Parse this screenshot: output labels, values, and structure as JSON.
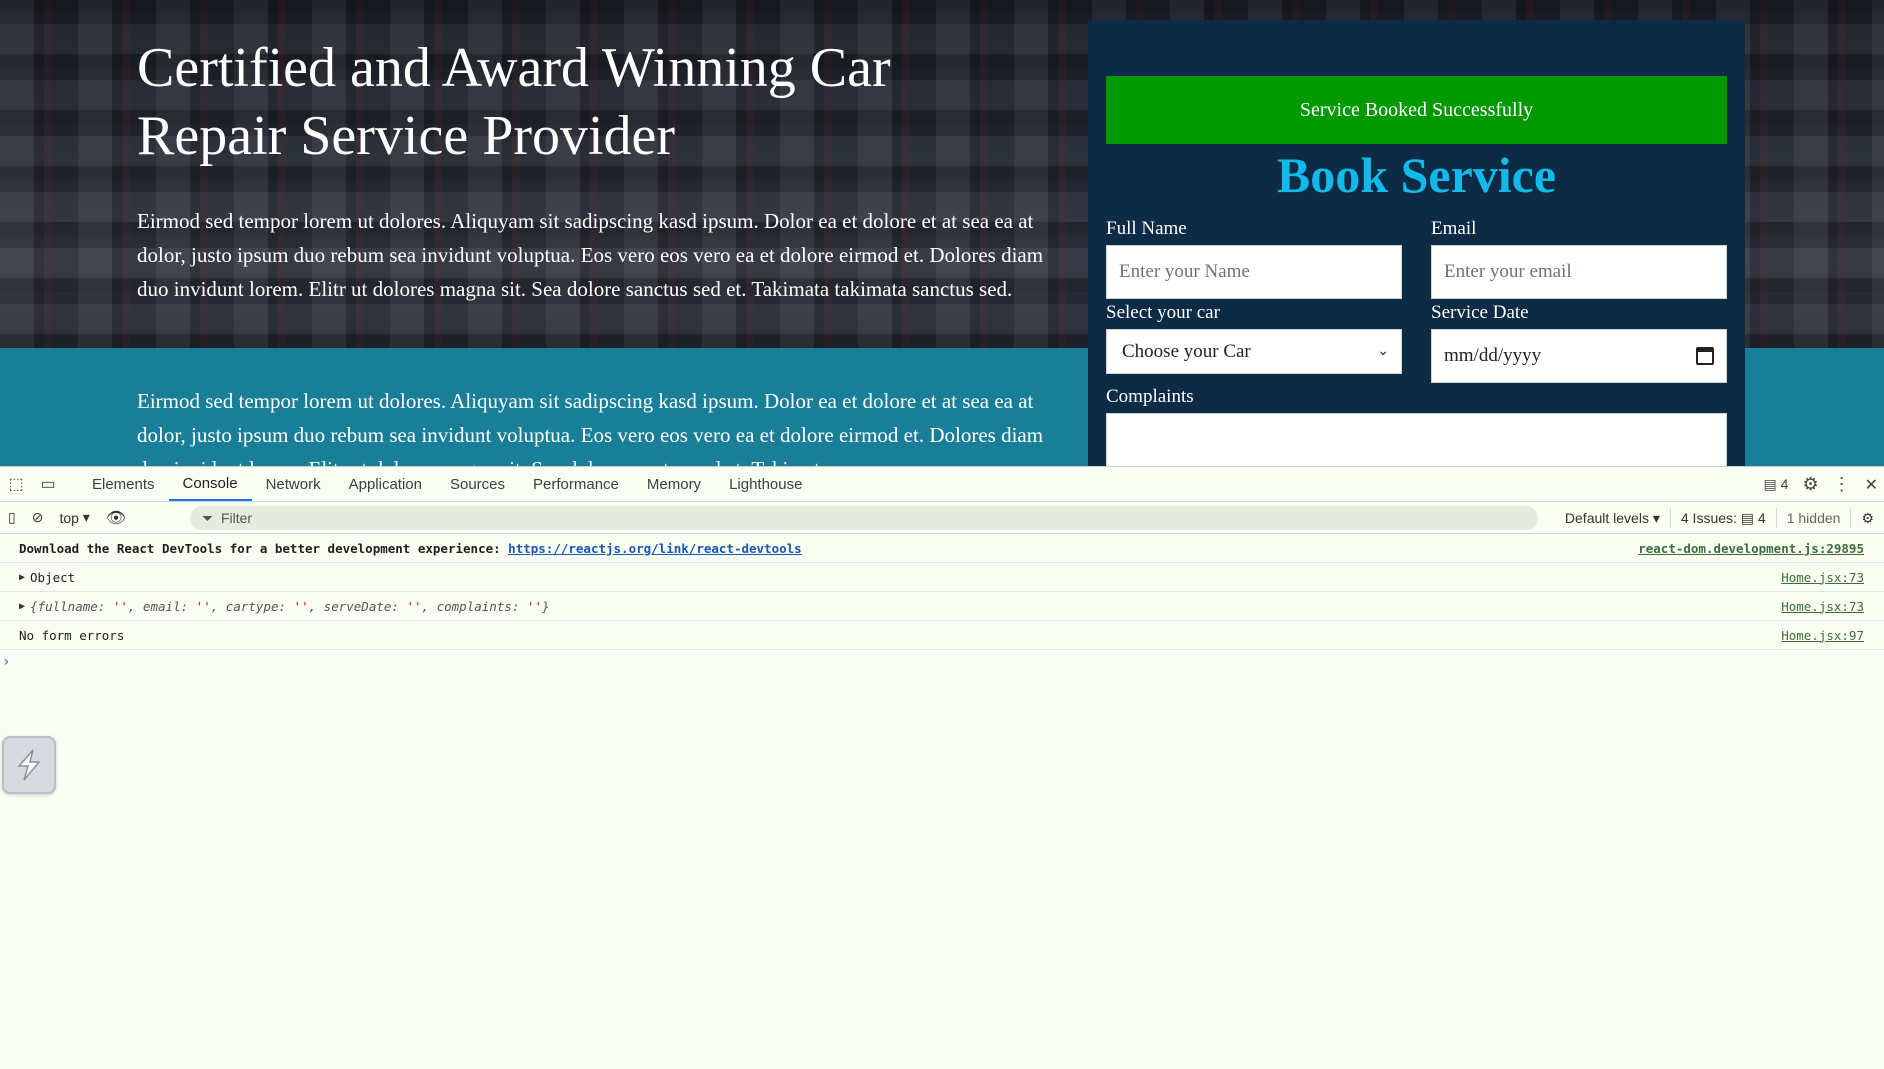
{
  "hero": {
    "title": "Certified and Award Winning Car Repair Service Provider",
    "text": "Eirmod sed tempor lorem ut dolores. Aliquyam sit sadipscing kasd ipsum. Dolor ea et dolore et at sea ea at dolor, justo ipsum duo rebum sea invidunt voluptua. Eos vero eos vero ea et dolore eirmod et. Dolores diam duo invidunt lorem. Elitr ut dolores magna sit. Sea dolore sanctus sed et. Takimata takimata sanctus sed.",
    "teal_text": "Eirmod sed tempor lorem ut dolores. Aliquyam sit sadipscing kasd ipsum. Dolor ea et dolore et at sea ea at dolor, justo ipsum duo rebum sea invidunt voluptua. Eos vero eos vero ea et dolore eirmod et. Dolores diam duo invidunt lorem. Elitr ut dolores magna sit. Sea dolore sanctus sed et. Takimata"
  },
  "form": {
    "success_message": "Service Booked Successfully",
    "title": "Book Service",
    "full_name_label": "Full Name",
    "full_name_placeholder": "Enter your Name",
    "email_label": "Email",
    "email_placeholder": "Enter your email",
    "car_label": "Select your car",
    "car_selected": "Choose your Car",
    "date_label": "Service Date",
    "date_placeholder": "mm/dd/yyyy",
    "complaints_label": "Complaints"
  },
  "devtools": {
    "tabs": [
      "Elements",
      "Console",
      "Network",
      "Application",
      "Sources",
      "Performance",
      "Memory",
      "Lighthouse"
    ],
    "active_tab": "Console",
    "message_count": "4",
    "context": "top",
    "filter_placeholder": "Filter",
    "levels": "Default levels",
    "issues_label": "4 Issues:",
    "issues_count": "4",
    "hidden": "1 hidden",
    "logs": {
      "devtools_msg": "Download the React DevTools for a better development experience: ",
      "devtools_link": "https://reactjs.org/link/react-devtools",
      "devtools_src": "react-dom.development.js:29895",
      "object_label": "Object",
      "object_src": "Home.jsx:73",
      "obj_open": "{",
      "obj_close": "}",
      "obj_fullname": "fullname",
      "obj_email": "email",
      "obj_cartype": "cartype",
      "obj_servedate": "serveDate",
      "obj_complaints": "complaints",
      "obj_empty": "''",
      "obj_src": "Home.jsx:73",
      "no_errors": "No form errors",
      "no_errors_src": "Home.jsx:97"
    }
  },
  "colors": {
    "success_green": "#009900",
    "form_title_blue": "#13b9e9",
    "teal_section": "#197f99",
    "form_background": "#0d2b45"
  }
}
